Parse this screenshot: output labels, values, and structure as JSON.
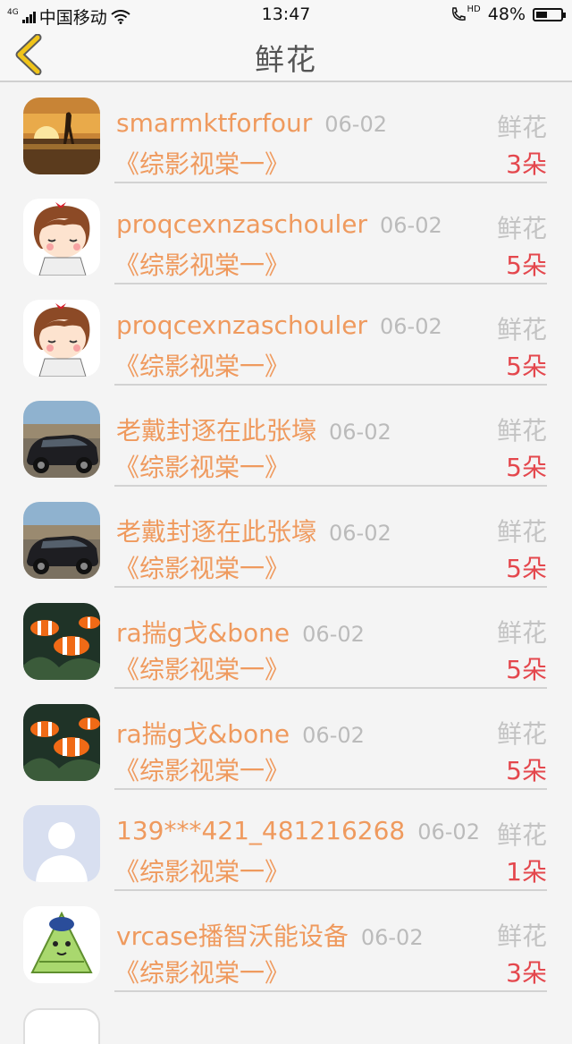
{
  "status_bar": {
    "network": "4G",
    "carrier": "中国移动",
    "time": "13:47",
    "call_badge": "HD",
    "battery": "48%",
    "battery_level": 0.48
  },
  "nav": {
    "title": "鲜花",
    "back_icon": "chevron-left-icon",
    "accent_color": "#f0c419"
  },
  "colors": {
    "name": "#ef9a5e",
    "count": "#e4474d",
    "meta": "#bbbbbb"
  },
  "items": [
    {
      "avatar": "sunset-silhouette",
      "name": "smarmktforfour",
      "date": "06-02",
      "show": "《综影视棠一》",
      "gift": "鲜花",
      "count": "3朵"
    },
    {
      "avatar": "cartoon-girl",
      "name": "proqcexnzaschouler",
      "date": "06-02",
      "show": "《综影视棠一》",
      "gift": "鲜花",
      "count": "5朵"
    },
    {
      "avatar": "cartoon-girl",
      "name": "proqcexnzaschouler",
      "date": "06-02",
      "show": "《综影视棠一》",
      "gift": "鲜花",
      "count": "5朵"
    },
    {
      "avatar": "black-car",
      "name": "老戴封逐在此张壕",
      "date": "06-02",
      "show": "《综影视棠一》",
      "gift": "鲜花",
      "count": "5朵"
    },
    {
      "avatar": "black-car",
      "name": "老戴封逐在此张壕",
      "date": "06-02",
      "show": "《综影视棠一》",
      "gift": "鲜花",
      "count": "5朵"
    },
    {
      "avatar": "clownfish",
      "name": "ra揣g戈&bone",
      "date": "06-02",
      "show": "《综影视棠一》",
      "gift": "鲜花",
      "count": "5朵"
    },
    {
      "avatar": "clownfish",
      "name": "ra揣g戈&bone",
      "date": "06-02",
      "show": "《综影视棠一》",
      "gift": "鲜花",
      "count": "5朵"
    },
    {
      "avatar": "default-user",
      "name": "139***421_481216268",
      "date": "06-02",
      "show": "《综影视棠一》",
      "gift": "鲜花",
      "count": "1朵"
    },
    {
      "avatar": "cartoon-zongzi",
      "name": "vrcase播智沃能设备",
      "date": "06-02",
      "show": "《综影视棠一》",
      "gift": "鲜花",
      "count": "3朵"
    }
  ]
}
